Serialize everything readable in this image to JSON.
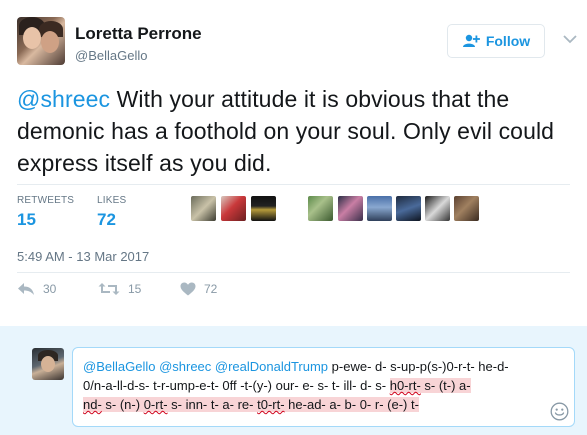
{
  "author": {
    "name": "Loretta Perrone",
    "handle": "@BellaGello"
  },
  "follow_label": "Follow",
  "tweet": {
    "mention": "@shreec",
    "text": " With your attitude it is obvious that the demonic has a foothold on your soul. Only evil could express itself as you did."
  },
  "stats": {
    "retweets_label": "RETWEETS",
    "retweets": "15",
    "likes_label": "LIKES",
    "likes": "72"
  },
  "timestamp": "5:49 AM - 13 Mar 2017",
  "actions": {
    "reply_count": "30",
    "retweet_count": "15",
    "like_count": "72"
  },
  "reply": {
    "mentions": "@BellaGello @shreec @realDonaldTrump",
    "seg1": " p-ewe- d- s-up-p(s-)0-r-t- he-d-0/n-a-ll-d-s- t-r-ump-e-t- 0ff -t-(y-) our- e- s- t- ill- d- s- ",
    "seg2_pre": "",
    "w1": "h0-rt-",
    "seg3": " s- (t-) a-",
    "seg4_a": "nd-",
    "seg4_b": " s- (n-) ",
    "w2": "0-rt-",
    "seg5": " s- inn- t- a- re- ",
    "w3": "t0-rt-",
    "seg6": " he-ad- a- b- 0- r- (e-) t-"
  },
  "colors": {
    "accent": "#1b95e0",
    "muted": "#657786",
    "reply_bg": "#e8f5fd",
    "highlight": "#f8d4d6"
  },
  "icons": {
    "follow": "add-user-icon",
    "menu": "chevron-down-icon",
    "reply": "reply-icon",
    "retweet": "retweet-icon",
    "like": "heart-icon",
    "emoji": "smiley-icon"
  }
}
